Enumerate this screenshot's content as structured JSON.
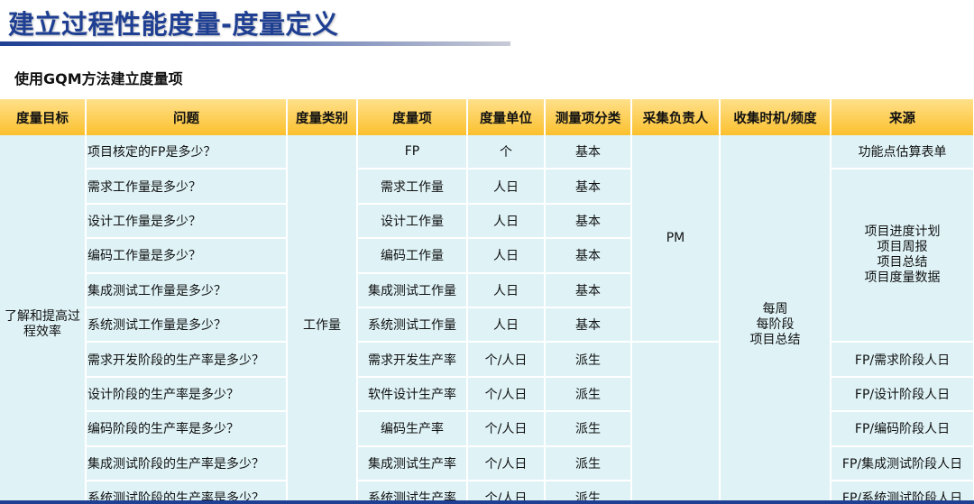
{
  "title": "建立过程性能度量-度量定义",
  "subtitle": "使用GQM方法建立度量项",
  "colors": {
    "title": "#1f3f93",
    "header_bg": "#fbc02d",
    "cell_bg": "#dff3f7"
  },
  "table": {
    "headers": [
      "度量目标",
      "问题",
      "度量类别",
      "度量项",
      "度量单位",
      "测量项分类",
      "采集负责人",
      "收集时机/频度",
      "来源"
    ],
    "goal": "了解和提高过程效率",
    "category": "工作量",
    "owner": "PM",
    "timing": [
      "每周",
      "每阶段",
      "项目总结"
    ],
    "source_group": [
      "项目进度计划",
      "项目周报",
      "项目总结",
      "项目度量数据"
    ],
    "rows": [
      {
        "question": "项目核定的FP是多少？",
        "item": "FP",
        "unit": "个",
        "kind": "基本",
        "source": "功能点估算表单"
      },
      {
        "question": "需求工作量是多少？",
        "item": "需求工作量",
        "unit": "人日",
        "kind": "基本"
      },
      {
        "question": "设计工作量是多少？",
        "item": "设计工作量",
        "unit": "人日",
        "kind": "基本"
      },
      {
        "question": "编码工作量是多少？",
        "item": "编码工作量",
        "unit": "人日",
        "kind": "基本"
      },
      {
        "question": "集成测试工作量是多少？",
        "item": "集成测试工作量",
        "unit": "人日",
        "kind": "基本"
      },
      {
        "question": "系统测试工作量是多少？",
        "item": "系统测试工作量",
        "unit": "人日",
        "kind": "基本"
      },
      {
        "question": "需求开发阶段的生产率是多少？",
        "item": "需求开发生产率",
        "unit": "个/人日",
        "kind": "派生",
        "source": "FP/需求阶段人日"
      },
      {
        "question": "设计阶段的生产率是多少？",
        "item": "软件设计生产率",
        "unit": "个/人日",
        "kind": "派生",
        "source": "FP/设计阶段人日"
      },
      {
        "question": "编码阶段的生产率是多少？",
        "item": "编码生产率",
        "unit": "个/人日",
        "kind": "派生",
        "source": "FP/编码阶段人日"
      },
      {
        "question": "集成测试阶段的生产率是多少？",
        "item": "集成测试生产率",
        "unit": "个/人日",
        "kind": "派生",
        "source": "FP/集成测试阶段人日"
      },
      {
        "question": "系统测试阶段的生产率是多少？",
        "item": "系统测试生产率",
        "unit": "个/人日",
        "kind": "派生",
        "source": "FP/系统测试阶段人日"
      }
    ]
  }
}
